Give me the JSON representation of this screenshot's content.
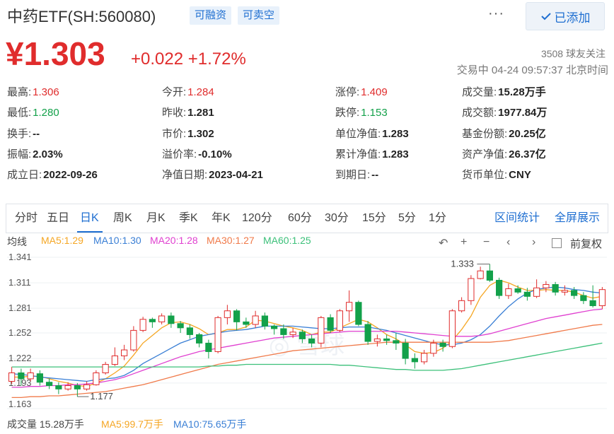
{
  "header": {
    "title": "中药ETF(SH:560080)",
    "tags": [
      "可融资",
      "可卖空"
    ],
    "more_label": "···",
    "added_label": "已添加"
  },
  "quote": {
    "price": "¥1.303",
    "change": "+0.022",
    "change_pct": "+1.72%",
    "followers": "3508 球友关注",
    "trade_status": "交易中 04-24 09:57:37 北京时间"
  },
  "stats": [
    {
      "label": "最高:",
      "value": "1.306",
      "tone": "up"
    },
    {
      "label": "今开:",
      "value": "1.284",
      "tone": "up"
    },
    {
      "label": "涨停:",
      "value": "1.409",
      "tone": "up"
    },
    {
      "label": "成交量:",
      "value": "15.28万手",
      "tone": ""
    },
    {
      "label": "最低:",
      "value": "1.280",
      "tone": "dn"
    },
    {
      "label": "昨收:",
      "value": "1.281",
      "tone": ""
    },
    {
      "label": "跌停:",
      "value": "1.153",
      "tone": "dn"
    },
    {
      "label": "成交额:",
      "value": "1977.84万",
      "tone": ""
    },
    {
      "label": "换手:",
      "value": "--",
      "tone": ""
    },
    {
      "label": "市价:",
      "value": "1.302",
      "tone": ""
    },
    {
      "label": "单位净值:",
      "value": "1.283",
      "tone": ""
    },
    {
      "label": "基金份额:",
      "value": "20.25亿",
      "tone": ""
    },
    {
      "label": "振幅:",
      "value": "2.03%",
      "tone": ""
    },
    {
      "label": "溢价率:",
      "value": "-0.10%",
      "tone": ""
    },
    {
      "label": "累计净值:",
      "value": "1.283",
      "tone": ""
    },
    {
      "label": "资产净值:",
      "value": "26.37亿",
      "tone": ""
    },
    {
      "label": "成立日:",
      "value": "2022-09-26",
      "tone": ""
    },
    {
      "label": "净值日期:",
      "value": "2023-04-21",
      "tone": ""
    },
    {
      "label": "到期日:",
      "value": "--",
      "tone": ""
    },
    {
      "label": "货币单位:",
      "value": "CNY",
      "tone": ""
    }
  ],
  "tabs": [
    "分时",
    "五日",
    "日K",
    "周K",
    "月K",
    "季K",
    "年K",
    "120分",
    "60分",
    "30分",
    "15分",
    "5分",
    "1分"
  ],
  "active_tab": "日K",
  "tab_actions": [
    "区间统计",
    "全屏展示"
  ],
  "legend": {
    "label": "均线",
    "ma": [
      {
        "text": "MA5:1.29",
        "color": "#f5a623"
      },
      {
        "text": "MA10:1.30",
        "color": "#3a7fd5"
      },
      {
        "text": "MA20:1.28",
        "color": "#e040d0"
      },
      {
        "text": "MA30:1.27",
        "color": "#f07a4a"
      },
      {
        "text": "MA60:1.25",
        "color": "#3cc07a"
      }
    ]
  },
  "controls": {
    "back_icon": "↶",
    "zoom_in_icon": "+",
    "zoom_out_icon": "−",
    "nav_left_icon": "‹",
    "nav_right_icon": "›",
    "adjust_label": "前复权"
  },
  "volume_bar": {
    "label": "成交量 15.28万手",
    "ma5": "MA5:99.7万手",
    "ma10": "MA10:75.65万手",
    "ma5_color": "#f5a623",
    "ma10_color": "#3a7fd5"
  },
  "colors": {
    "up": "#e02c2c",
    "down": "#13a14a",
    "accent": "#1f6fd1"
  },
  "chart_data": {
    "type": "candlestick",
    "y_ticks": [
      "1.341",
      "1.311",
      "1.281",
      "1.252",
      "1.222",
      "1.193",
      "1.163"
    ],
    "ylim": [
      1.163,
      1.341
    ],
    "max_label": "1.333",
    "min_label": "1.177",
    "candles": [
      [
        1.195,
        1.205,
        1.192,
        1.212
      ],
      [
        1.205,
        1.198,
        1.19,
        1.21
      ],
      [
        1.198,
        1.205,
        1.195,
        1.21
      ],
      [
        1.204,
        1.194,
        1.19,
        1.208
      ],
      [
        1.194,
        1.19,
        1.186,
        1.198
      ],
      [
        1.19,
        1.186,
        1.18,
        1.194
      ],
      [
        1.186,
        1.19,
        1.184,
        1.194
      ],
      [
        1.19,
        1.186,
        1.177,
        1.193
      ],
      [
        1.186,
        1.191,
        1.184,
        1.195
      ],
      [
        1.191,
        1.205,
        1.19,
        1.208
      ],
      [
        1.205,
        1.215,
        1.203,
        1.218
      ],
      [
        1.215,
        1.225,
        1.213,
        1.235
      ],
      [
        1.225,
        1.232,
        1.22,
        1.238
      ],
      [
        1.232,
        1.255,
        1.23,
        1.26
      ],
      [
        1.255,
        1.268,
        1.253,
        1.271
      ],
      [
        1.268,
        1.265,
        1.258,
        1.27
      ],
      [
        1.265,
        1.272,
        1.262,
        1.275
      ],
      [
        1.272,
        1.263,
        1.258,
        1.276
      ],
      [
        1.263,
        1.258,
        1.252,
        1.266
      ],
      [
        1.258,
        1.25,
        1.245,
        1.262
      ],
      [
        1.25,
        1.24,
        1.235,
        1.252
      ],
      [
        1.24,
        1.23,
        1.222,
        1.244
      ],
      [
        1.23,
        1.27,
        1.228,
        1.272
      ],
      [
        1.27,
        1.278,
        1.262,
        1.285
      ],
      [
        1.278,
        1.265,
        1.255,
        1.28
      ],
      [
        1.265,
        1.262,
        1.258,
        1.27
      ],
      [
        1.262,
        1.272,
        1.258,
        1.278
      ],
      [
        1.272,
        1.26,
        1.256,
        1.276
      ],
      [
        1.26,
        1.257,
        1.25,
        1.262
      ],
      [
        1.257,
        1.25,
        1.245,
        1.262
      ],
      [
        1.25,
        1.253,
        1.246,
        1.258
      ],
      [
        1.253,
        1.245,
        1.24,
        1.256
      ],
      [
        1.245,
        1.24,
        1.235,
        1.25
      ],
      [
        1.24,
        1.27,
        1.235,
        1.272
      ],
      [
        1.27,
        1.255,
        1.252,
        1.274
      ],
      [
        1.255,
        1.278,
        1.253,
        1.28
      ],
      [
        1.278,
        1.288,
        1.265,
        1.302
      ],
      [
        1.288,
        1.262,
        1.26,
        1.29
      ],
      [
        1.262,
        1.242,
        1.238,
        1.266
      ],
      [
        1.242,
        1.245,
        1.236,
        1.25
      ],
      [
        1.245,
        1.243,
        1.238,
        1.25
      ],
      [
        1.243,
        1.24,
        1.232,
        1.252
      ],
      [
        1.24,
        1.222,
        1.215,
        1.245
      ],
      [
        1.222,
        1.218,
        1.21,
        1.228
      ],
      [
        1.218,
        1.228,
        1.215,
        1.232
      ],
      [
        1.228,
        1.24,
        1.224,
        1.244
      ],
      [
        1.24,
        1.236,
        1.23,
        1.244
      ],
      [
        1.236,
        1.278,
        1.234,
        1.28
      ],
      [
        1.278,
        1.29,
        1.276,
        1.294
      ],
      [
        1.29,
        1.316,
        1.285,
        1.32
      ],
      [
        1.316,
        1.325,
        1.315,
        1.33
      ],
      [
        1.325,
        1.314,
        1.312,
        1.333
      ],
      [
        1.314,
        1.296,
        1.292,
        1.317
      ],
      [
        1.296,
        1.304,
        1.292,
        1.31
      ],
      [
        1.304,
        1.3,
        1.298,
        1.308
      ],
      [
        1.3,
        1.295,
        1.29,
        1.305
      ],
      [
        1.295,
        1.305,
        1.293,
        1.315
      ],
      [
        1.305,
        1.309,
        1.3,
        1.313
      ],
      [
        1.309,
        1.3,
        1.296,
        1.312
      ],
      [
        1.3,
        1.302,
        1.296,
        1.308
      ],
      [
        1.302,
        1.296,
        1.292,
        1.306
      ],
      [
        1.296,
        1.29,
        1.286,
        1.3
      ],
      [
        1.29,
        1.284,
        1.282,
        1.308
      ],
      [
        1.284,
        1.303,
        1.28,
        1.306
      ]
    ],
    "ma_lines": [
      {
        "name": "MA5",
        "color": "#f5a623",
        "values": [
          1.2,
          1.2,
          1.201,
          1.201,
          1.198,
          1.195,
          1.193,
          1.19,
          1.189,
          1.193,
          1.198,
          1.205,
          1.213,
          1.226,
          1.24,
          1.249,
          1.258,
          1.264,
          1.265,
          1.262,
          1.257,
          1.25,
          1.252,
          1.256,
          1.256,
          1.259,
          1.267,
          1.266,
          1.263,
          1.26,
          1.258,
          1.255,
          1.25,
          1.253,
          1.253,
          1.258,
          1.263,
          1.268,
          1.265,
          1.258,
          1.25,
          1.245,
          1.238,
          1.23,
          1.228,
          1.229,
          1.234,
          1.243,
          1.256,
          1.272,
          1.294,
          1.308,
          1.314,
          1.311,
          1.306,
          1.302,
          1.302,
          1.303,
          1.302,
          1.302,
          1.3,
          1.296,
          1.293,
          1.295
        ]
      },
      {
        "name": "MA10",
        "color": "#3a7fd5",
        "values": [
          1.204,
          1.203,
          1.202,
          1.2,
          1.199,
          1.198,
          1.197,
          1.196,
          1.195,
          1.197,
          1.198,
          1.199,
          1.202,
          1.208,
          1.216,
          1.222,
          1.228,
          1.234,
          1.24,
          1.244,
          1.248,
          1.25,
          1.252,
          1.254,
          1.255,
          1.256,
          1.258,
          1.26,
          1.26,
          1.26,
          1.26,
          1.259,
          1.258,
          1.257,
          1.257,
          1.258,
          1.259,
          1.259,
          1.259,
          1.257,
          1.255,
          1.252,
          1.249,
          1.246,
          1.243,
          1.24,
          1.238,
          1.238,
          1.24,
          1.244,
          1.25,
          1.26,
          1.272,
          1.283,
          1.292,
          1.299,
          1.303,
          1.305,
          1.306,
          1.305,
          1.303,
          1.302,
          1.3,
          1.299
        ]
      },
      {
        "name": "MA20",
        "color": "#e040d0",
        "values": [
          1.188,
          1.188,
          1.189,
          1.189,
          1.19,
          1.19,
          1.191,
          1.191,
          1.192,
          1.193,
          1.195,
          1.197,
          1.2,
          1.204,
          1.208,
          1.212,
          1.216,
          1.22,
          1.224,
          1.227,
          1.23,
          1.232,
          1.234,
          1.236,
          1.238,
          1.24,
          1.242,
          1.244,
          1.246,
          1.247,
          1.248,
          1.249,
          1.25,
          1.251,
          1.252,
          1.253,
          1.254,
          1.254,
          1.254,
          1.254,
          1.254,
          1.254,
          1.253,
          1.252,
          1.251,
          1.25,
          1.249,
          1.248,
          1.248,
          1.248,
          1.249,
          1.251,
          1.254,
          1.257,
          1.26,
          1.263,
          1.266,
          1.269,
          1.271,
          1.273,
          1.275,
          1.277,
          1.279,
          1.28
        ]
      },
      {
        "name": "MA30",
        "color": "#f07a4a",
        "values": [
          1.176,
          1.176,
          1.177,
          1.177,
          1.178,
          1.178,
          1.179,
          1.18,
          1.181,
          1.182,
          1.183,
          1.185,
          1.187,
          1.189,
          1.191,
          1.194,
          1.197,
          1.2,
          1.203,
          1.206,
          1.209,
          1.212,
          1.215,
          1.217,
          1.219,
          1.221,
          1.223,
          1.225,
          1.227,
          1.229,
          1.231,
          1.232,
          1.233,
          1.234,
          1.235,
          1.236,
          1.237,
          1.238,
          1.239,
          1.24,
          1.241,
          1.241,
          1.241,
          1.241,
          1.241,
          1.241,
          1.241,
          1.241,
          1.241,
          1.241,
          1.241,
          1.241,
          1.242,
          1.243,
          1.245,
          1.247,
          1.249,
          1.251,
          1.253,
          1.255,
          1.257,
          1.259,
          1.261,
          1.262
        ]
      },
      {
        "name": "MA60",
        "color": "#3cc07a",
        "values": [
          1.212,
          1.212,
          1.212,
          1.212,
          1.212,
          1.212,
          1.212,
          1.212,
          1.212,
          1.212,
          1.212,
          1.212,
          1.212,
          1.212,
          1.212,
          1.212,
          1.212,
          1.212,
          1.212,
          1.212,
          1.212,
          1.213,
          1.213,
          1.214,
          1.214,
          1.215,
          1.215,
          1.215,
          1.215,
          1.215,
          1.215,
          1.215,
          1.215,
          1.215,
          1.215,
          1.214,
          1.214,
          1.213,
          1.212,
          1.211,
          1.21,
          1.209,
          1.209,
          1.208,
          1.208,
          1.208,
          1.208,
          1.209,
          1.21,
          1.212,
          1.214,
          1.216,
          1.218,
          1.22,
          1.222,
          1.224,
          1.226,
          1.228,
          1.23,
          1.232,
          1.234,
          1.236,
          1.238,
          1.24
        ]
      }
    ],
    "grid": true
  }
}
